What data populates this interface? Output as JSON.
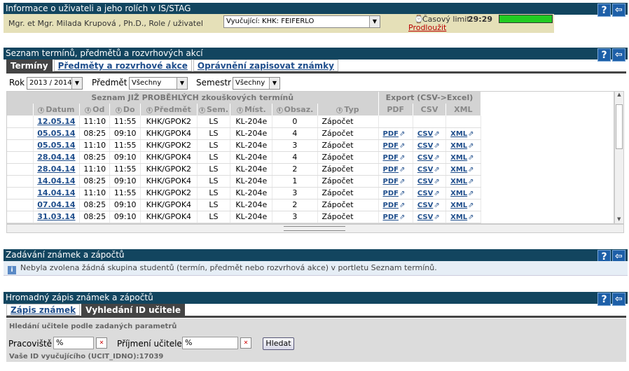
{
  "header1": {
    "title": "Informace o uživateli a jeho rolích v IS/STAG"
  },
  "userbar": {
    "user_text": "Mgr. et Mgr. Milada Krupová , Ph.D., Role / uživatel",
    "role_select": "Vyučující: KHK: FEIFERLO",
    "time_label": "Časový limit:",
    "time_value": "29:29",
    "extend_link": "Prodloužit",
    "progress_fraction": 1.0
  },
  "header2": {
    "title": "Seznam termínů, předmětů a rozvrhových akcí"
  },
  "tabs1": [
    "Termíny",
    "Předměty a rozvrhové akce",
    "Oprávnění zapisovat známky"
  ],
  "filters": {
    "rok_label": "Rok",
    "rok_value": "2013 / 2014",
    "predmet_label": "Předmět",
    "predmet_value": "Všechny",
    "semestr_label": "Semestr",
    "semestr_value": "Všechny"
  },
  "table": {
    "group_title": "Seznam JIŽ PROBĚHLÝCH zkouškových termínů",
    "export_title": "Export (CSV->Excel)",
    "columns": [
      "Datum",
      "Od",
      "Do",
      "Předmět",
      "Sem.",
      "Míst.",
      "Obsaz.",
      "Typ",
      "PDF",
      "CSV",
      "XML"
    ],
    "export_labels": {
      "pdf": "PDF",
      "csv": "CSV",
      "xml": "XML"
    },
    "rows": [
      {
        "datum": "12.05.14",
        "od": "11:10",
        "do": "11:55",
        "predmet": "KHK/GPOK2",
        "sem": "LS",
        "mist": "KL-204e",
        "obsaz": "0",
        "typ": "Zápočet",
        "export": false
      },
      {
        "datum": "05.05.14",
        "od": "08:25",
        "do": "09:10",
        "predmet": "KHK/GPOK4",
        "sem": "LS",
        "mist": "KL-204e",
        "obsaz": "4",
        "typ": "Zápočet",
        "export": true
      },
      {
        "datum": "05.05.14",
        "od": "11:10",
        "do": "11:55",
        "predmet": "KHK/GPOK2",
        "sem": "LS",
        "mist": "KL-204e",
        "obsaz": "3",
        "typ": "Zápočet",
        "export": true
      },
      {
        "datum": "28.04.14",
        "od": "08:25",
        "do": "09:10",
        "predmet": "KHK/GPOK4",
        "sem": "LS",
        "mist": "KL-204e",
        "obsaz": "4",
        "typ": "Zápočet",
        "export": true
      },
      {
        "datum": "28.04.14",
        "od": "11:10",
        "do": "11:55",
        "predmet": "KHK/GPOK2",
        "sem": "LS",
        "mist": "KL-204e",
        "obsaz": "2",
        "typ": "Zápočet",
        "export": true
      },
      {
        "datum": "14.04.14",
        "od": "08:25",
        "do": "09:10",
        "predmet": "KHK/GPOK4",
        "sem": "LS",
        "mist": "KL-204e",
        "obsaz": "1",
        "typ": "Zápočet",
        "export": true
      },
      {
        "datum": "14.04.14",
        "od": "11:10",
        "do": "11:55",
        "predmet": "KHK/GPOK2",
        "sem": "LS",
        "mist": "KL-204e",
        "obsaz": "3",
        "typ": "Zápočet",
        "export": true
      },
      {
        "datum": "07.04.14",
        "od": "08:25",
        "do": "09:10",
        "predmet": "KHK/GPOK4",
        "sem": "LS",
        "mist": "KL-204e",
        "obsaz": "2",
        "typ": "Zápočet",
        "export": true
      },
      {
        "datum": "31.03.14",
        "od": "08:25",
        "do": "09:10",
        "predmet": "KHK/GPOK4",
        "sem": "LS",
        "mist": "KL-204e",
        "obsaz": "3",
        "typ": "Zápočet",
        "export": true
      }
    ]
  },
  "header3": {
    "title": "Zadávání známek a zápočtů"
  },
  "info_msg": "Nebyla zvolena žádná skupina studentů (termín, předmět nebo rozvrhová akce) v portletu Seznam termínů.",
  "header4": {
    "title": "Hromadný zápis známek a zápočtů"
  },
  "tabs2": [
    "Zápis známek",
    "Vyhledání ID učitele"
  ],
  "search": {
    "section_title": "Hledání učitele podle zadaných parametrů",
    "pracoviste_label": "Pracoviště",
    "pracoviste_value": "%",
    "prijmeni_label": "Příjmení učitele",
    "prijmeni_value": "%",
    "button": "Hledat",
    "result": "Vaše ID vyučujícího (UCIT_IDNO):17039"
  },
  "colors": {
    "header_bg": "#12455f",
    "userbar_bg": "#e5e0b8",
    "link": "#1f4e8c",
    "progress": "#22cc22"
  },
  "icons": {
    "help": "help-icon",
    "back": "back-arrow-icon",
    "info": "info-icon",
    "export": "export-icon",
    "clock": "clock-icon",
    "clear": "clear-icon",
    "sort": "sort-icon"
  }
}
